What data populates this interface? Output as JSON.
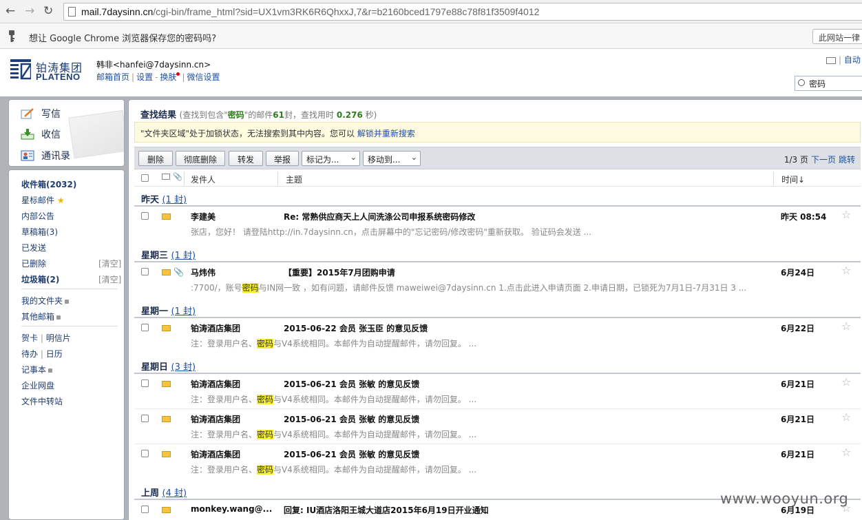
{
  "browser": {
    "url_domain": "mail.7daysinn.cn",
    "url_path": "/cgi-bin/frame_html?sid=UX1vm3RK6R6QhxxJ,7&r=b2160bced1797e88c78f81f3509f4012",
    "password_prompt": "想让 Google Chrome 浏览器保存您的密码吗?",
    "never_button": "此网站一律"
  },
  "header": {
    "logo_cn": "铂涛集团",
    "logo_en": "PLATENO",
    "user": "韩非<hanfei@7daysinn.cn>",
    "links": [
      "邮箱首页",
      "设置",
      "换肤",
      "微信设置"
    ],
    "auto_label": "自动",
    "search_value": "密码"
  },
  "sidebar": {
    "actions": [
      "写信",
      "收信",
      "通讯录"
    ],
    "folders": [
      {
        "label": "收件箱(2032)",
        "bold": true
      },
      {
        "label": "星标邮件",
        "star": true
      },
      {
        "label": "内部公告"
      },
      {
        "label": "草稿箱(3)"
      },
      {
        "label": "已发送"
      },
      {
        "label": "已删除",
        "clear": "[清空]"
      },
      {
        "label": "垃圾箱(2)",
        "bold": true,
        "clear": "[清空]"
      }
    ],
    "my_folders": "我的文件夹",
    "other_mailboxes": "其他邮箱",
    "cards": "贺卡",
    "postcards": "明信片",
    "todo": "待办",
    "calendar": "日历",
    "notes": "记事本",
    "netdisk": "企业网盘",
    "transfer": "文件中转站"
  },
  "results": {
    "title": "查找结果",
    "desc_pre": "(查找到包含\"",
    "keyword": "密码",
    "desc_mid": "\"的邮件",
    "count": "61",
    "desc_mid2": "封，查找用时",
    "time": "0.276",
    "desc_post": "秒)",
    "notice": "\"文件夹区域\"处于加锁状态，无法搜索到其中内容。您可以",
    "notice_link": "解锁并重新搜索"
  },
  "toolbar": {
    "delete": "删除",
    "delete_forever": "彻底删除",
    "forward": "转发",
    "report": "举报",
    "mark_as": "标记为...",
    "move_to": "移动到...",
    "page_info": "1/3 页",
    "next_page": "下一页",
    "jump": "跳转"
  },
  "columns": {
    "sender": "发件人",
    "subject": "主题",
    "time": "时间↓"
  },
  "groups": [
    {
      "label": "昨天",
      "count": "(1 封)"
    },
    {
      "label": "星期三",
      "count": "(1 封)"
    },
    {
      "label": "星期一",
      "count": "(1 封)"
    },
    {
      "label": "星期日",
      "count": "(3 封)"
    },
    {
      "label": "上周",
      "count": "(4 封)"
    }
  ],
  "emails": [
    {
      "sender": "李建美",
      "subject": "Re: 常熟供应商天上人间洗涤公司申报系统密码修改",
      "snippet_pre": "张店，您好！ 请登陆http://in.7daysinn.cn，点击屏幕中的\"忘记密码/修改密码\"重新获取。 验证码会发送 ...",
      "snippet_hl": "",
      "snippet_post": "",
      "date": "昨天 08:54",
      "attach": false
    },
    {
      "sender": "马炜伟",
      "subject": "【重要】2015年7月团购申请",
      "snippet_pre": ":7700/，账号",
      "snippet_hl": "密码",
      "snippet_post": "与IN网一致 ，如有问题，请邮件反馈 maweiwei@7daysinn.cn 1.点击此进入申请页面 2.申请日期，已锁死为7月1日-7月31日 3 ...",
      "date": "6月24日",
      "attach": true
    },
    {
      "sender": "铂涛酒店集团",
      "subject": "2015-06-22 会员 张玉臣 的意见反馈",
      "snippet_pre": "注：登录用户名、",
      "snippet_hl": "密码",
      "snippet_post": "与V4系统相同。本邮件为自动提醒邮件，请勿回复。 ...",
      "date": "6月22日",
      "attach": false
    },
    {
      "sender": "铂涛酒店集团",
      "subject": "2015-06-21 会员 张敏 的意见反馈",
      "snippet_pre": "注：登录用户名、",
      "snippet_hl": "密码",
      "snippet_post": "与V4系统相同。本邮件为自动提醒邮件，请勿回复。 ...",
      "date": "6月21日",
      "attach": false
    },
    {
      "sender": "铂涛酒店集团",
      "subject": "2015-06-21 会员 张敏 的意见反馈",
      "snippet_pre": "注：登录用户名、",
      "snippet_hl": "密码",
      "snippet_post": "与V4系统相同。本邮件为自动提醒邮件，请勿回复。 ...",
      "date": "6月21日",
      "attach": false
    },
    {
      "sender": "铂涛酒店集团",
      "subject": "2015-06-21 会员 张敏 的意见反馈",
      "snippet_pre": "注：登录用户名、",
      "snippet_hl": "密码",
      "snippet_post": "与V4系统相同。本邮件为自动提醒邮件，请勿回复。 ...",
      "date": "6月21日",
      "attach": false
    },
    {
      "sender": "monkey.wang@...",
      "subject": "回复: IU酒店洛阳王城大道店2015年6月19日开业通知",
      "snippet_pre": "",
      "snippet_hl": "",
      "snippet_post": "",
      "date": "6月19日",
      "attach": false
    }
  ],
  "watermark": "www.wooyun.org",
  "colors": {
    "frame": "#b0b4b8",
    "link": "#1e50a2",
    "highlight": "#f5ee2b",
    "notice_bg": "#fffbe1"
  }
}
